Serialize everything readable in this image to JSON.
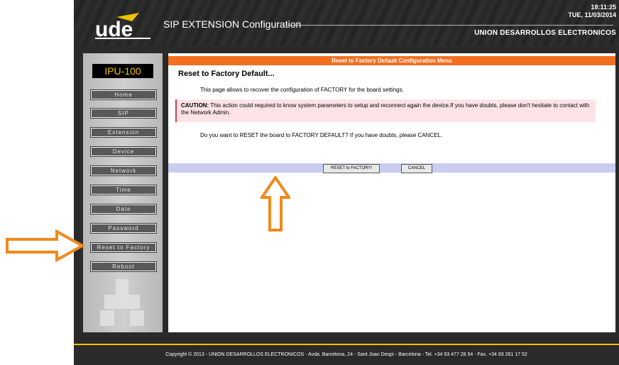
{
  "header": {
    "logo_text": "ude",
    "app_title": "SIP EXTENSION Configuration",
    "time": "18:11:25",
    "date": "TUE, 11/03/2014",
    "company": "UNION DESARROLLOS ELECTRONICOS"
  },
  "sidebar": {
    "device_name": "IPU-100",
    "items": [
      {
        "label": "Home"
      },
      {
        "label": "SIP"
      },
      {
        "label": "Extension"
      },
      {
        "label": "Device"
      },
      {
        "label": "Network"
      },
      {
        "label": "Time"
      },
      {
        "label": "Date"
      },
      {
        "label": "Password"
      },
      {
        "label": "Reset to Factory"
      },
      {
        "label": "Reboot"
      }
    ],
    "active_item": "Reset to Factory"
  },
  "main": {
    "menu_title": "Reset to Factory Default Configuration Menu",
    "heading": "Reset to Factory Default...",
    "description": "This page allows to recover the configuration of FACTORY for the board settings.",
    "caution_label": "CAUTION:",
    "caution_text": " This action could required to know system parameters to setup and reconnect again the device.If you have doubts, please don't hesitate to contact with the Network Admin.",
    "question": "Do you want to RESET the board to FACTORY DEFAULT? If you have doubts, please CANCEL.",
    "buttons": {
      "reset": "RESET to FACTORY!",
      "cancel": "CANCEL"
    }
  },
  "footer": {
    "text": "Copyright  © 2013 - UNION DESARROLLOS ELECTRONICOS  -  Avda. Barcelona, 24 - Sant Joan Despí  -  Barcelona  -  Tel. +34 93 477 28 54  -  Fax. +34 93 261 17 52"
  },
  "colors": {
    "accent_orange": "#f37020",
    "device_text": "#f0c000",
    "caution_bg": "#fde3e6",
    "button_bar": "#c9cdf0",
    "nav_button": "#595959"
  },
  "icons": [
    "ude-logo",
    "arrow-up-icon",
    "arrow-right-icon"
  ]
}
